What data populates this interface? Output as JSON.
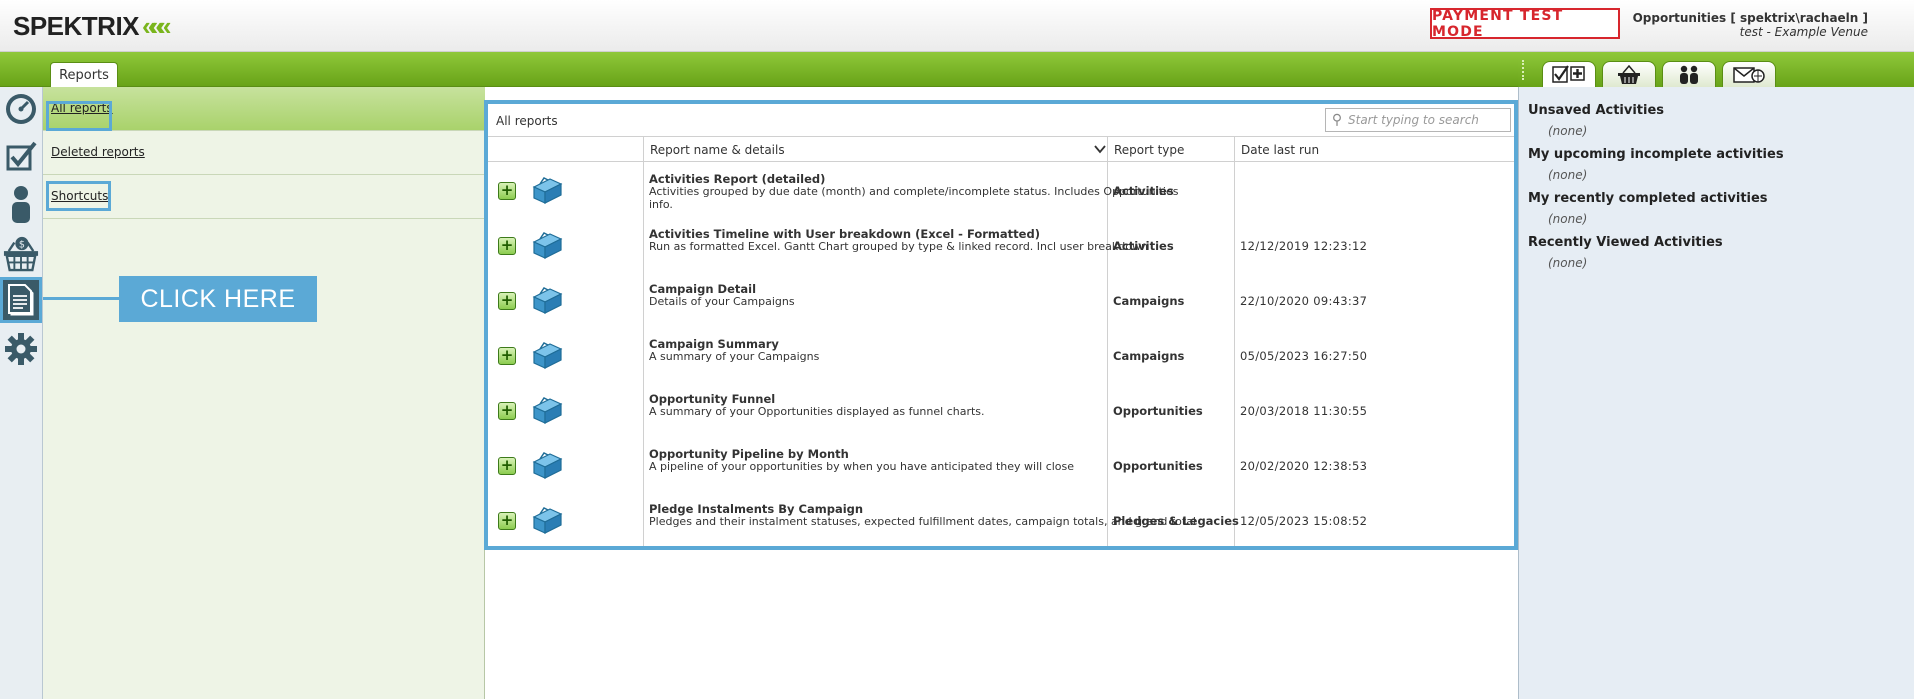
{
  "header": {
    "logo_text": "SPEKTRIX",
    "logo_chevrons": "«««",
    "payment_badge": "PAYMENT TEST MODE",
    "user_line1": "Opportunities [ spektrix\\rachaeln ]",
    "user_line2": "test - Example Venue"
  },
  "tabs": {
    "reports_label": "Reports"
  },
  "right_tabs": [
    "activities-tab-icon",
    "basket-tab-icon",
    "customers-tab-icon",
    "messages-tab-icon"
  ],
  "rail": [
    "dashboard-icon",
    "tasks-icon",
    "customer-icon",
    "basket-icon",
    "reports-icon",
    "settings-icon"
  ],
  "leftnav": {
    "all_reports": "All reports",
    "deleted_reports": "Deleted reports",
    "shortcuts": "Shortcuts"
  },
  "callout": "CLICK HERE",
  "grid": {
    "title": "All reports",
    "search_placeholder": "Start typing to search",
    "col_name": "Report name & details",
    "col_type": "Report type",
    "col_date": "Date last run"
  },
  "reports": [
    {
      "name": "Activities Report (detailed)",
      "desc": "Activities grouped by due date (month) and complete/incomplete status. Includes Opportunities info.",
      "type": "Activities",
      "date": ""
    },
    {
      "name": "Activities Timeline with User breakdown (Excel - Formatted)",
      "desc": "Run as formatted Excel. Gantt Chart grouped by type & linked record. Incl user breakdown",
      "type": "Activities",
      "date": "12/12/2019 12:23:12"
    },
    {
      "name": "Campaign Detail",
      "desc": "Details of your Campaigns",
      "type": "Campaigns",
      "date": "22/10/2020 09:43:37"
    },
    {
      "name": "Campaign Summary",
      "desc": "A summary of your Campaigns",
      "type": "Campaigns",
      "date": "05/05/2023 16:27:50"
    },
    {
      "name": "Opportunity Funnel",
      "desc": "A summary of your Opportunities displayed as funnel charts.",
      "type": "Opportunities",
      "date": "20/03/2018 11:30:55"
    },
    {
      "name": "Opportunity Pipeline by Month",
      "desc": "A pipeline of your opportunities by when you have anticipated they will close",
      "type": "Opportunities",
      "date": "20/02/2020 12:38:53"
    },
    {
      "name": "Pledge Instalments By Campaign",
      "desc": "Pledges and their instalment statuses, expected fulfillment dates, campaign totals, and grand total",
      "type": "Pledges & Legacies",
      "date": "12/05/2023 15:08:52"
    }
  ],
  "rightpanel": {
    "sections": [
      {
        "title": "Unsaved Activities",
        "value": "(none)"
      },
      {
        "title": "My upcoming incomplete activities",
        "value": "(none)"
      },
      {
        "title": "My recently completed activities",
        "value": "(none)"
      },
      {
        "title": "Recently Viewed Activities",
        "value": "(none)"
      }
    ]
  },
  "colors": {
    "accent_blue": "#5ba9d6",
    "brand_green": "#7ab51d",
    "alert_red": "#d7262d"
  }
}
